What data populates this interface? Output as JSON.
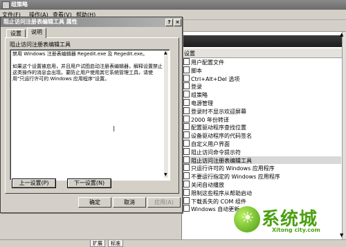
{
  "main_window": {
    "title": "组策略",
    "menu": [
      "文件(F)",
      "操作(A)",
      "查看(V)",
      "帮助(H)"
    ],
    "list_header": "设置",
    "list_items": [
      "用户配置文件",
      "脚本",
      "Ctrl+Alt+Del 选项",
      "登录",
      "组策略",
      "电源管理",
      "登录时不显示欢迎屏幕",
      "2000 年份转译",
      "配置驱动程序查找位置",
      "设备驱动程序的代码签名",
      "自定义用户界面",
      "阻止访问命令提示符",
      "阻止访问注册表编辑工具",
      "只运行许可的 Windows 应用程序",
      "不要运行指定的 Windows 应用程序",
      "关闭自动播放",
      "限制这些程序从帮助启动",
      "下载丢失的 COM 组件",
      "Windows 自动更新"
    ],
    "selected_index": 12,
    "status_tabs": [
      "扩展",
      "标准"
    ]
  },
  "watermark": {
    "logo_mark": "☀",
    "brand": "系统城",
    "url": "Xitong city.com"
  },
  "dialog": {
    "title": "阻止访问注册表编辑工具 属性",
    "help_glyph": "?",
    "close_glyph": "×",
    "tabs": [
      "设置",
      "说明"
    ],
    "active_tab": "说明",
    "policy_name": "阻止访问注册表编辑工具",
    "explain_text": "禁用 Windows 注册表编辑器 Regedit.exe 及 Regedit.exe。\n\n如果这个设置被启用，并且用户试图启动注册表编辑器，解释设置禁止这类操作的消息会出现。要防止用户使用其它系统管理工具，请使用\"只运行许可的 Windows 应用程序\"设置。",
    "prev_button": "上一设置(P)",
    "next_button": "下一设置(N)",
    "ok_button": "确定",
    "cancel_button": "取消",
    "apply_button": "应用(A)"
  }
}
